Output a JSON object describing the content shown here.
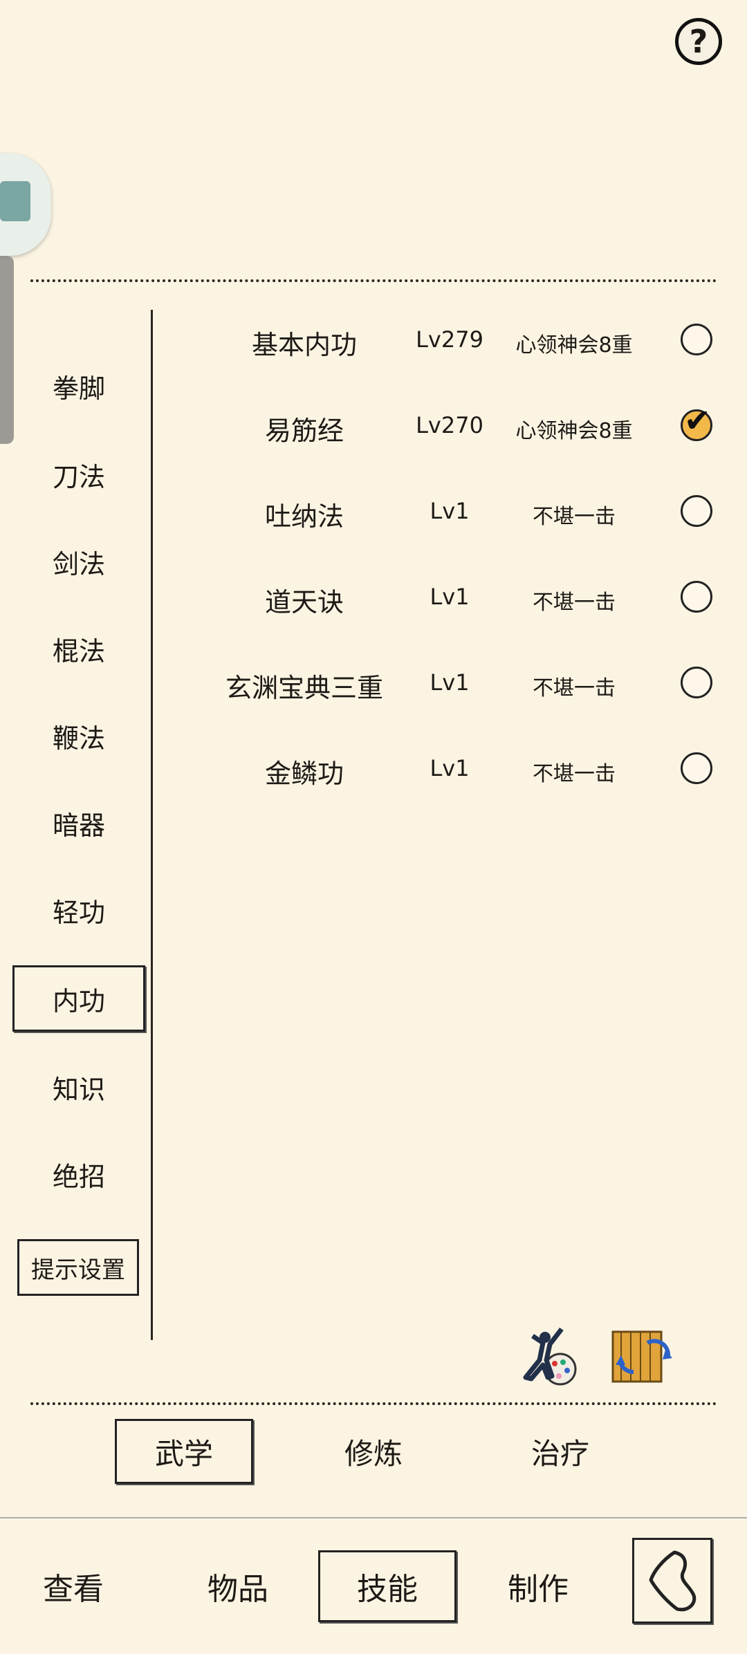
{
  "header": {
    "help_label": "?"
  },
  "categories": [
    {
      "label": "拳脚"
    },
    {
      "label": "刀法"
    },
    {
      "label": "剑法"
    },
    {
      "label": "棍法"
    },
    {
      "label": "鞭法"
    },
    {
      "label": "暗器"
    },
    {
      "label": "轻功"
    },
    {
      "label": "内功"
    },
    {
      "label": "知识"
    },
    {
      "label": "绝招"
    }
  ],
  "active_category": "内功",
  "settings_label": "提示设置",
  "skills": [
    {
      "name": "基本内功",
      "level": "Lv279",
      "rank": "心领神会8重",
      "selected": false
    },
    {
      "name": "易筋经",
      "level": "Lv270",
      "rank": "心领神会8重",
      "selected": true
    },
    {
      "name": "吐纳法",
      "level": "Lv1",
      "rank": "不堪一击",
      "selected": false
    },
    {
      "name": "道天诀",
      "level": "Lv1",
      "rank": "不堪一击",
      "selected": false
    },
    {
      "name": "玄渊宝典三重",
      "level": "Lv1",
      "rank": "不堪一击",
      "selected": false
    },
    {
      "name": "金鳞功",
      "level": "Lv1",
      "rank": "不堪一击",
      "selected": false
    }
  ],
  "check_glyph": "✔",
  "tools": [
    "swordsman-palette-icon",
    "scroll-swap-icon"
  ],
  "subtabs": [
    {
      "label": "武学"
    },
    {
      "label": "修炼"
    },
    {
      "label": "治疗"
    }
  ],
  "active_subtab": "武学",
  "nav": [
    {
      "label": "查看"
    },
    {
      "label": "物品"
    },
    {
      "label": "技能"
    },
    {
      "label": "制作"
    }
  ],
  "active_nav": "技能",
  "colors": {
    "background": "#fbf4e3",
    "ink": "#1d1a16",
    "check_fill": "#f2b94a"
  }
}
